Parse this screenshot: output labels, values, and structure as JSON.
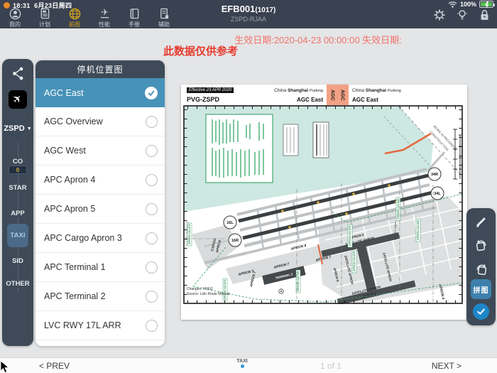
{
  "statusbar": {
    "time": "18:31",
    "date": "6月23日周四",
    "battery_pct": "100%"
  },
  "nav": {
    "tabs": [
      {
        "label": "我的"
      },
      {
        "label": "计划"
      },
      {
        "label": "航图"
      },
      {
        "label": "性能"
      },
      {
        "label": "手册"
      },
      {
        "label": "辅助"
      }
    ],
    "title": "EFB001",
    "flight_no": "(1017)",
    "route": "ZSPD-RJAA"
  },
  "notice": {
    "validity": "生效日期:2020-04-23 00:00:00 失效日期:",
    "disclaimer": "此数据仅供参考"
  },
  "sidebar": {
    "airport": "ZSPD",
    "dropdown_arrow": "▼",
    "categories": [
      {
        "label": "CO",
        "badge": "0"
      },
      {
        "label": "STAR"
      },
      {
        "label": "APP"
      },
      {
        "label": "TAXI"
      },
      {
        "label": "SID"
      },
      {
        "label": "OTHER"
      }
    ]
  },
  "chart_list": {
    "title": "停机位置图",
    "items": [
      {
        "label": "AGC East"
      },
      {
        "label": "AGC Overview"
      },
      {
        "label": "AGC West"
      },
      {
        "label": "APC Apron 4"
      },
      {
        "label": "APC Apron 5"
      },
      {
        "label": "APC Cargo Apron 3"
      },
      {
        "label": "APC Terminal 1"
      },
      {
        "label": "APC Terminal 2"
      },
      {
        "label": "LVC RWY 17L ARR"
      }
    ]
  },
  "chart": {
    "effective": "Effective 23 APR 2020",
    "route": "PVG-ZSPD",
    "city_prefix": "China",
    "city": "Shanghai",
    "city_suffix": "Pudong",
    "name": "AGC East",
    "tab": "AGC",
    "changes": "Changes: FREQ",
    "source": "Source: Lido Route Manual",
    "map": {
      "rwy_34r": "34R",
      "rwy_34l": "34L",
      "rwy_16l": "16L",
      "rwy_16r": "16R",
      "apron7": "APRON 7",
      "apron8": "APRON 8",
      "apron5": "APRON 5",
      "apron4": "APRON 4",
      "satellite": "SATELLITE APRON",
      "terminal2": "TERMINAL 2",
      "cargo1": "CARGO",
      "cargo2": "APRON",
      "wip_top1": "WORK IN PROGRESS",
      "wip_top2": "CONSTRUCTION",
      "wip_gray": "WORK IN PROGRESS",
      "see_left": "See APC Terminal 2",
      "see_right": "See APC Apron",
      "freq_labels": [
        "APRON 121.975",
        "APRON 121.875",
        "APRON 122.700",
        "APRON 121.975",
        "APRON 121.875",
        "APRON 121.650",
        "APRON 121.600"
      ]
    }
  },
  "tools": {
    "mosaic_label": "拼图"
  },
  "footer": {
    "prev": "< PREV",
    "mode": "TAXI",
    "page": "1 of 1",
    "next": "NEXT >"
  }
}
